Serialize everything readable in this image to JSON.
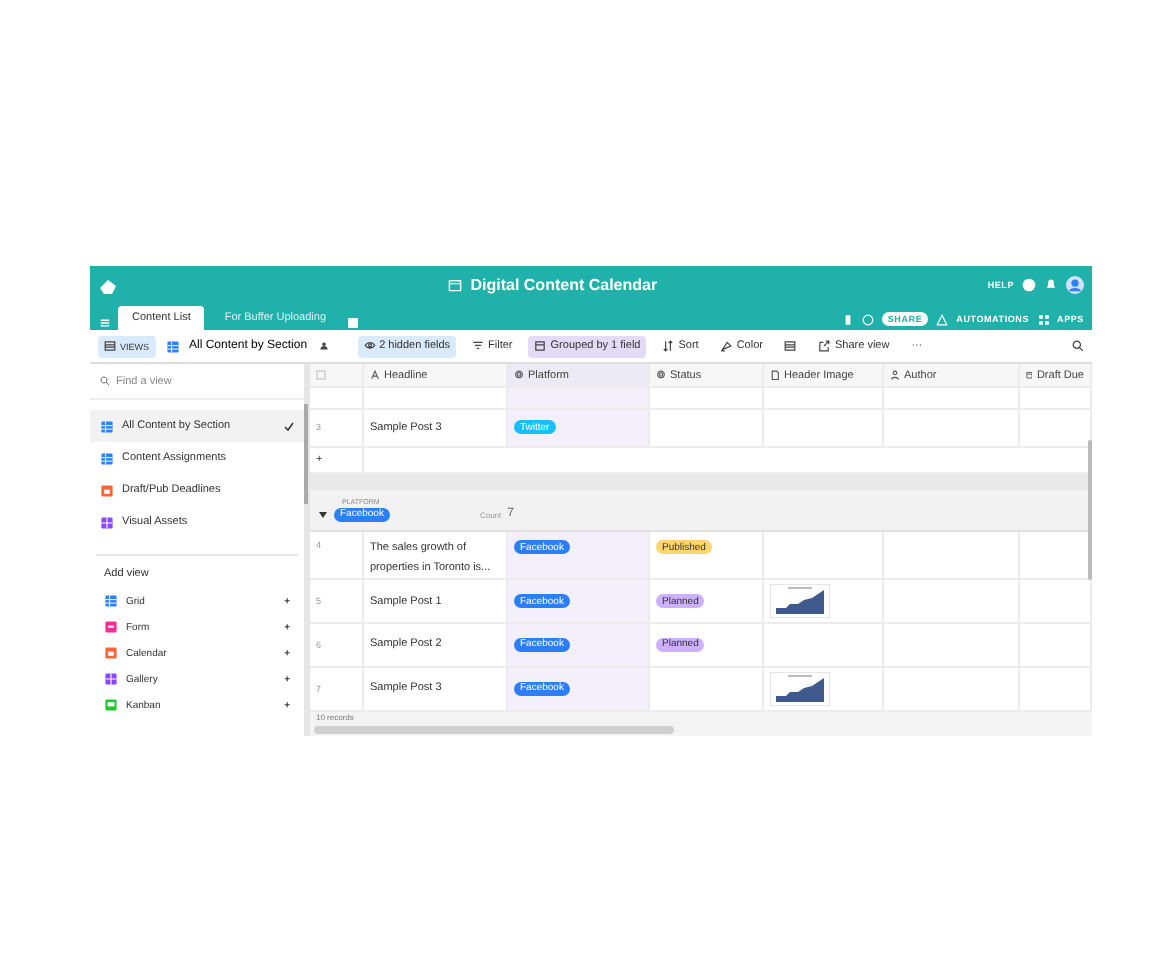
{
  "header": {
    "title": "Digital Content Calendar",
    "help": "HELP",
    "tabs": [
      {
        "label": "Content List",
        "selected": true
      },
      {
        "label": "For Buffer Uploading",
        "selected": false
      }
    ],
    "share": "SHARE",
    "automations": "AUTOMATIONS",
    "apps": "APPS"
  },
  "toolbar": {
    "views": "VIEWS",
    "current_view": "All Content by Section",
    "buttons": [
      {
        "label": "2 hidden fields",
        "kind": "hide",
        "active": true
      },
      {
        "label": "Filter",
        "kind": "filter",
        "active": false
      },
      {
        "label": "Grouped by 1 field",
        "kind": "group",
        "active": true
      },
      {
        "label": "Sort",
        "kind": "sort",
        "active": false
      },
      {
        "label": "Color",
        "kind": "color",
        "active": false
      },
      {
        "kind": "height",
        "active": false
      },
      {
        "label": "Share view",
        "kind": "share",
        "active": false
      },
      {
        "label": "···",
        "kind": "more",
        "active": false
      }
    ]
  },
  "sidebar": {
    "search": {
      "placeholder": "Find a view"
    },
    "views": [
      {
        "label": "All Content by Section",
        "kind": "grid",
        "color": "#2d7ff9",
        "selected": true
      },
      {
        "label": "Content Assignments",
        "kind": "grid",
        "color": "#2d7ff9",
        "selected": false
      },
      {
        "label": "Draft/Pub Deadlines",
        "kind": "calendar",
        "color": "#f7653b",
        "selected": false
      },
      {
        "label": "Visual Assets",
        "kind": "gallery",
        "color": "#8b46ff",
        "selected": false
      }
    ],
    "add_view_heading": "Add view",
    "add_views": [
      {
        "label": "Grid",
        "kind": "grid",
        "color": "#2d7ff9",
        "action": "+"
      },
      {
        "label": "Form",
        "kind": "form",
        "color": "#f82b99",
        "action": "+"
      },
      {
        "label": "Calendar",
        "kind": "calendar",
        "color": "#f7653b",
        "action": "+"
      },
      {
        "label": "Gallery",
        "kind": "gallery",
        "color": "#8b46ff",
        "action": "+"
      },
      {
        "label": "Kanban",
        "kind": "kanban",
        "color": "#20c933",
        "action": "+"
      }
    ]
  },
  "grid": {
    "columns": [
      {
        "label": "Headline",
        "kind": "text"
      },
      {
        "label": "Platform",
        "kind": "select"
      },
      {
        "label": "Status",
        "kind": "select"
      },
      {
        "label": "Header Image",
        "kind": "attachment"
      },
      {
        "label": "Author",
        "kind": "user"
      },
      {
        "label": "Draft Due",
        "kind": "date"
      }
    ],
    "rows_before": [
      {
        "number": "3",
        "headline": "Sample Post 3",
        "platform": {
          "label": "Twitter",
          "color": "#18bfff"
        }
      }
    ],
    "add_row": "+",
    "group": {
      "field": "PLATFORM",
      "value": {
        "label": "Facebook",
        "color": "#2d7ff9"
      },
      "count_label": "Count",
      "count": "7",
      "expanded": true,
      "rows": [
        {
          "number": "4",
          "headline": "The sales growth of properties in Toronto is...",
          "platform": {
            "label": "Facebook",
            "color": "#2d7ff9"
          },
          "status": {
            "label": "Published",
            "color": "#ffd66e"
          }
        },
        {
          "number": "5",
          "headline": "Sample Post 1",
          "platform": {
            "label": "Facebook",
            "color": "#2d7ff9"
          },
          "status": {
            "label": "Planned",
            "color": "#cdb0ff"
          }
        },
        {
          "number": "6",
          "headline": "Sample Post 2",
          "platform": {
            "label": "Facebook",
            "color": "#2d7ff9"
          },
          "status": {
            "label": "Planned",
            "color": "#cdb0ff"
          }
        },
        {
          "number": "7",
          "headline": "Sample Post 3",
          "platform": {
            "label": "Facebook",
            "color": "#2d7ff9"
          }
        }
      ]
    },
    "footer": "10 records"
  }
}
